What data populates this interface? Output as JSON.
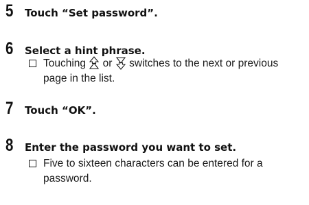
{
  "steps": [
    {
      "number": "5",
      "title": "Touch “Set password”."
    },
    {
      "number": "6",
      "title": "Select a hint phrase."
    },
    {
      "number": "7",
      "title": "Touch “OK”."
    },
    {
      "number": "8",
      "title": "Enter the password you want to set."
    }
  ],
  "notes": {
    "step6": {
      "before": "Touching",
      "middle": "or",
      "after": "switches to the next or previous page in the list.",
      "icons": [
        "page-up-icon",
        "page-down-icon"
      ]
    },
    "step8": {
      "text": "Five to sixteen characters can be entered for a password."
    }
  }
}
